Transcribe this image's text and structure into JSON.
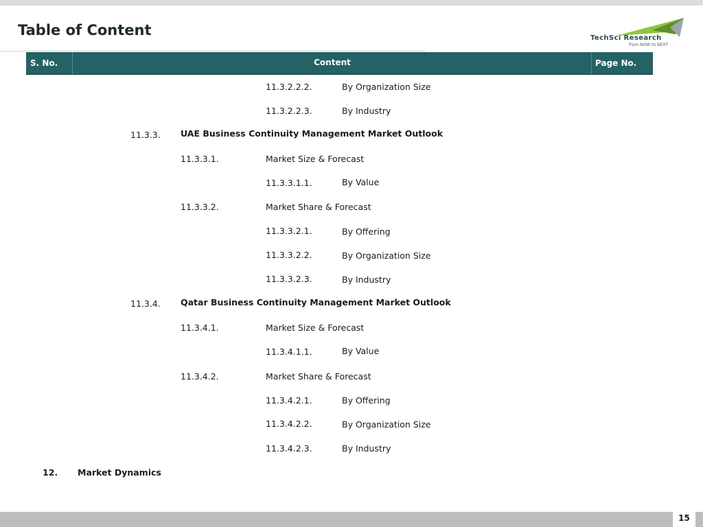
{
  "title": "Table of Content",
  "logo": {
    "name": "TechSci Research",
    "tagline": "from NOW to NEXT"
  },
  "header": {
    "sno": "S. No.",
    "content": "Content",
    "page": "Page No."
  },
  "rows": [
    {
      "num": "11.3.2.2.2.",
      "text": "By Organization Size"
    },
    {
      "num": "11.3.2.2.3.",
      "text": "By Industry"
    },
    {
      "num": "11.3.3.",
      "text": "UAE Business Continuity Management Market Outlook"
    },
    {
      "num": "11.3.3.1.",
      "text": "Market Size & Forecast"
    },
    {
      "num": "11.3.3.1.1.",
      "text": "By Value"
    },
    {
      "num": "11.3.3.2.",
      "text": "Market Share & Forecast"
    },
    {
      "num": "11.3.3.2.1.",
      "text": "By Offering"
    },
    {
      "num": "11.3.3.2.2.",
      "text": "By Organization Size"
    },
    {
      "num": "11.3.3.2.3.",
      "text": "By Industry"
    },
    {
      "num": "11.3.4.",
      "text": "Qatar Business Continuity Management Market Outlook"
    },
    {
      "num": "11.3.4.1.",
      "text": "Market Size & Forecast"
    },
    {
      "num": "11.3.4.1.1.",
      "text": "By Value"
    },
    {
      "num": "11.3.4.2.",
      "text": "Market Share & Forecast"
    },
    {
      "num": "11.3.4.2.1.",
      "text": "By Offering"
    },
    {
      "num": "11.3.4.2.2.",
      "text": "By Organization Size"
    },
    {
      "num": "11.3.4.2.3.",
      "text": "By Industry"
    },
    {
      "num": "12.",
      "text": "Market Dynamics"
    }
  ],
  "page_number": "15",
  "colors": {
    "header_bg": "#246266",
    "logo_green": "#8dc63f",
    "logo_teal": "#2d4a4e"
  }
}
